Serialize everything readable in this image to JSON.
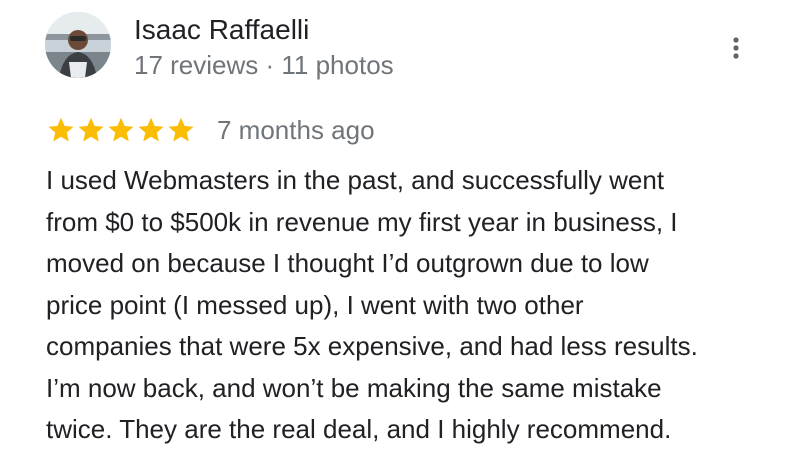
{
  "reviewer": {
    "name": "Isaac Raffaelli",
    "meta": "17 reviews · 11 photos"
  },
  "review": {
    "rating": 5,
    "max_rating": 5,
    "age": "7 months ago",
    "text": "I used Webmasters in the past, and successfully went\nfrom $0 to $500k in revenue my first year in business, I\nmoved on because I thought I’d outgrown due to low\nprice point (I messed up), I went with two other\ncompanies that were 5x expensive, and had less results.\nI’m now back, and won’t be making the same mistake\ntwice. They are the real deal, and I highly recommend."
  },
  "icons": {
    "more": "more-vert-icon",
    "star": "star-icon"
  },
  "colors": {
    "star": "#fbbc04",
    "primary_text": "#202124",
    "secondary_text": "#70757a",
    "menu_dots": "#5f6368"
  }
}
